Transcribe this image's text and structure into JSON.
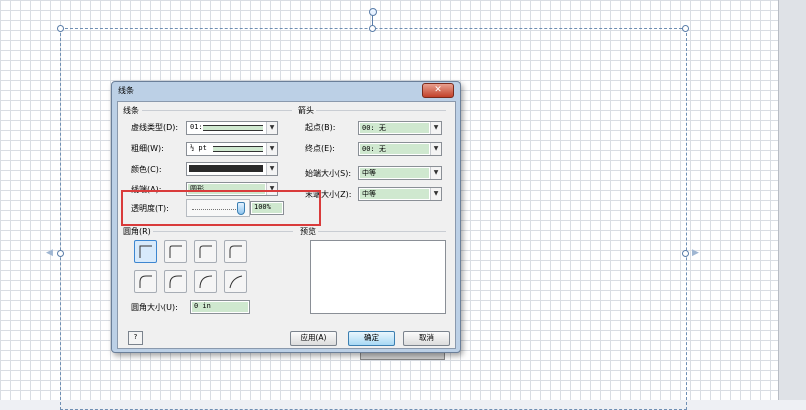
{
  "dialog": {
    "title": "线条",
    "close_label": "✕",
    "line_section": "线条",
    "dash_type_label": "虚线类型(D):",
    "dash_type_value": "01:",
    "weight_label": "粗细(W):",
    "weight_value": "½ pt",
    "color_label": "颜色(C):",
    "cap_label": "线端(A):",
    "cap_value": "圆形",
    "transparency_label": "透明度(T):",
    "transparency_value": "100%",
    "transparency_level": 1.0,
    "arrows_section": "箭头",
    "begin_label": "起点(B):",
    "begin_value": "00: 无",
    "end_label": "终点(E):",
    "end_value": "00: 无",
    "begin_size_label": "始端大小(S):",
    "begin_size_value": "中等",
    "end_size_label": "末端大小(Z):",
    "end_size_value": "中等",
    "rounding_section": "圆角(R)",
    "rounding_size_label": "圆角大小(U):",
    "rounding_size_value": "0 in",
    "preview_section": "预览",
    "help_label": "?",
    "apply_label": "应用(A)",
    "ok_label": "确定",
    "cancel_label": "取消"
  },
  "colors": {
    "line_color": "#2a2a2a",
    "highlight": "#d93b3b",
    "field_green": "#cfe8cf"
  }
}
